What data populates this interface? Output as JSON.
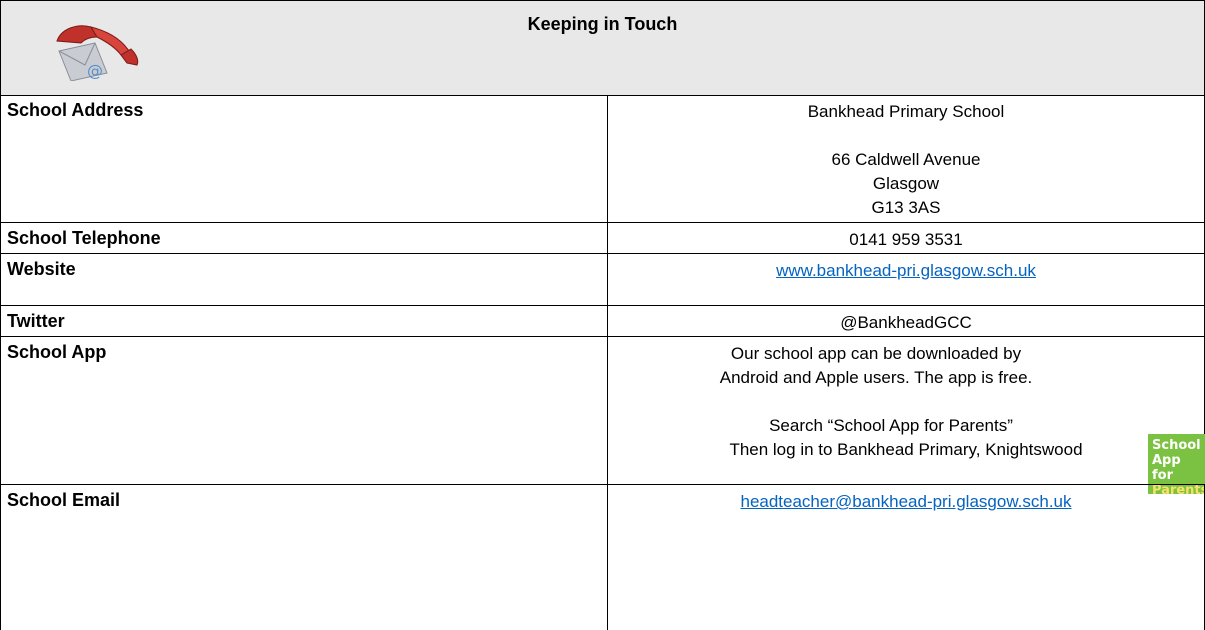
{
  "header": {
    "title": "Keeping in Touch",
    "icon": "telephone-email-icon"
  },
  "rows": {
    "address": {
      "label": "School Address",
      "lines": [
        "Bankhead Primary School",
        "",
        "66 Caldwell Avenue",
        "Glasgow",
        "G13 3AS"
      ]
    },
    "telephone": {
      "label": "School Telephone",
      "value": "0141 959 3531"
    },
    "website": {
      "label": "Website",
      "value": "www.bankhead-pri.glasgow.sch.uk"
    },
    "twitter": {
      "label": "Twitter",
      "value": "@BankheadGCC"
    },
    "app": {
      "label": "School App",
      "lines": [
        "Our school app can be downloaded by",
        "Android and Apple users. The app is free.",
        "",
        "Search “School App for Parents”",
        "Then log in to Bankhead Primary, Knightswood"
      ],
      "badge": {
        "line1": "School",
        "line2": "App for",
        "line3": "Parents"
      }
    },
    "email": {
      "label": "School Email",
      "value": "headteacher@bankhead-pri.glasgow.sch.uk"
    }
  },
  "colors": {
    "link": "#0563c1",
    "header_bg": "#e8e8e8",
    "badge_bg": "#7cc242"
  }
}
